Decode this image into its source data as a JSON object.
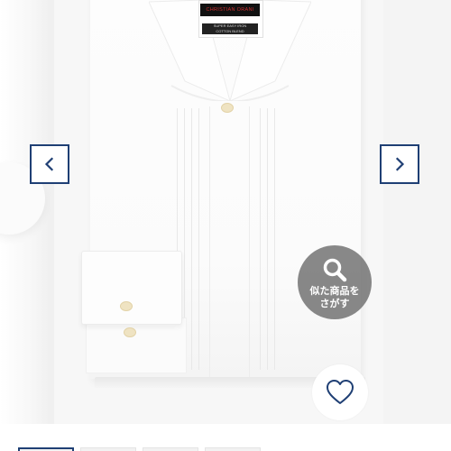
{
  "product_image": {
    "brand_label": "CHRISTIAN ORANI",
    "tag_label_line1": "SUPER EASY IRON",
    "tag_label_line2": "COTTON BLEND"
  },
  "carousel": {
    "prev_icon": "chevron-left-icon",
    "next_icon": "chevron-right-icon",
    "accent_color": "#1f3f74",
    "thumbnails": [
      {
        "active": true
      },
      {
        "active": false
      },
      {
        "active": false
      },
      {
        "active": false
      }
    ]
  },
  "similar_search": {
    "icon": "search-icon",
    "label_line1": "似た商品を",
    "label_line2": "さがす"
  },
  "favorite": {
    "icon": "heart-outline-icon"
  }
}
